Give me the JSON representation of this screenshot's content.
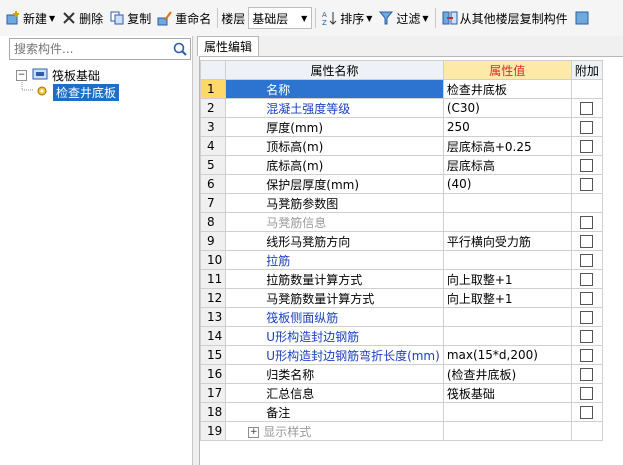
{
  "toolbar": {
    "new_label": "新建",
    "delete_label": "删除",
    "copy_label": "复制",
    "rename_label": "重命名",
    "floor_label": "楼层",
    "floor_value": "基础层",
    "sort_label": "排序",
    "filter_label": "过滤",
    "copy_from_floor_label": "从其他楼层复制构件"
  },
  "sidebar": {
    "search_placeholder": "搜索构件...",
    "tree": [
      {
        "label": "筏板基础",
        "expanded": true
      },
      {
        "label": "检查井底板",
        "selected": true
      }
    ]
  },
  "panel": {
    "tab_label": "属性编辑",
    "columns": [
      "属性名称",
      "属性值",
      "附加"
    ]
  },
  "rows": [
    {
      "num": "1",
      "name": "名称",
      "value": "检查井底板",
      "style": "normal",
      "checkbox": false
    },
    {
      "num": "2",
      "name": "混凝土强度等级",
      "value": "(C30)",
      "style": "blue",
      "checkbox": true
    },
    {
      "num": "3",
      "name": "厚度(mm)",
      "value": "250",
      "style": "normal",
      "checkbox": true
    },
    {
      "num": "4",
      "name": "顶标高(m)",
      "value": "层底标高+0.25",
      "style": "normal",
      "checkbox": true
    },
    {
      "num": "5",
      "name": "底标高(m)",
      "value": "层底标高",
      "style": "normal",
      "checkbox": true
    },
    {
      "num": "6",
      "name": "保护层厚度(mm)",
      "value": "(40)",
      "style": "normal",
      "checkbox": true
    },
    {
      "num": "7",
      "name": "马凳筋参数图",
      "value": "",
      "style": "normal",
      "checkbox": false
    },
    {
      "num": "8",
      "name": "马凳筋信息",
      "value": "",
      "style": "gray",
      "checkbox": true
    },
    {
      "num": "9",
      "name": "线形马凳筋方向",
      "value": "平行横向受力筋",
      "style": "normal",
      "checkbox": true
    },
    {
      "num": "10",
      "name": "拉筋",
      "value": "",
      "style": "blue",
      "checkbox": true
    },
    {
      "num": "11",
      "name": "拉筋数量计算方式",
      "value": "向上取整+1",
      "style": "normal",
      "checkbox": true
    },
    {
      "num": "12",
      "name": "马凳筋数量计算方式",
      "value": "向上取整+1",
      "style": "normal",
      "checkbox": true
    },
    {
      "num": "13",
      "name": "筏板侧面纵筋",
      "value": "",
      "style": "blue",
      "checkbox": true
    },
    {
      "num": "14",
      "name": "U形构造封边钢筋",
      "value": "",
      "style": "blue",
      "checkbox": true
    },
    {
      "num": "15",
      "name": "U形构造封边钢筋弯折长度(mm)",
      "value": "max(15*d,200)",
      "style": "blue",
      "checkbox": true
    },
    {
      "num": "16",
      "name": "归类名称",
      "value": "(检查井底板)",
      "style": "normal",
      "checkbox": true
    },
    {
      "num": "17",
      "name": "汇总信息",
      "value": "筏板基础",
      "style": "normal",
      "checkbox": true
    },
    {
      "num": "18",
      "name": "备注",
      "value": "",
      "style": "normal",
      "checkbox": true
    },
    {
      "num": "19",
      "name": "显示样式",
      "value": "",
      "style": "gray",
      "checkbox": false,
      "expandable": true
    }
  ]
}
